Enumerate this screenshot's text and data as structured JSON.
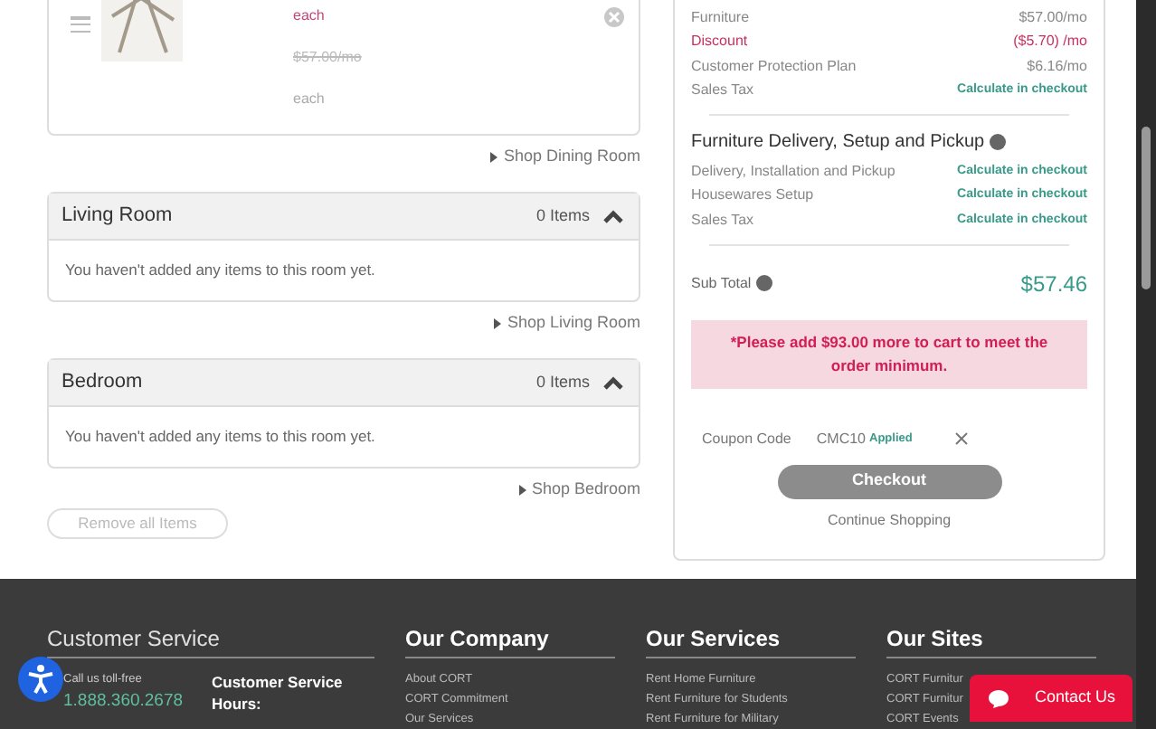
{
  "dining_item": {
    "price_note": "each",
    "original_price": "$57.00/mo",
    "unit": "each"
  },
  "dining_shop_link": "Shop Dining Room",
  "rooms": [
    {
      "name": "Living Room",
      "count": "0 Items",
      "expanded": true,
      "empty_message": "You haven't added any items to this room yet.",
      "shop_link": "Shop Living Room"
    },
    {
      "name": "Bedroom",
      "count": "0 Items",
      "expanded": true,
      "empty_message": "You haven't added any items to this room yet.",
      "shop_link": "Shop Bedroom"
    }
  ],
  "remove_all": "Remove all Items",
  "summary": {
    "lines": [
      {
        "label": "Furniture",
        "value": "$57.00/mo",
        "kind": "charge"
      },
      {
        "label": "Discount",
        "value": "($5.70) /mo",
        "kind": "discount"
      },
      {
        "label": "Customer Protection Plan",
        "value": "$6.16/mo",
        "kind": "charge"
      },
      {
        "label": "Sales Tax",
        "value": "Calculate in checkout",
        "kind": "pending"
      }
    ],
    "delivery_title": "Furniture Delivery, Setup and Pickup",
    "delivery_lines": [
      {
        "label": "Delivery, Installation and Pickup",
        "value": "Calculate in checkout",
        "kind": "pending"
      },
      {
        "label": "Housewares Setup",
        "value": "Calculate in checkout",
        "kind": "pending"
      },
      {
        "label": "Sales Tax",
        "value": "Calculate in checkout",
        "kind": "pending"
      }
    ],
    "subtotal_label": "Sub Total",
    "subtotal": "$57.46",
    "warning": "*Please add $93.00 more to cart to meet the order minimum.",
    "coupon_label": "Coupon Code",
    "coupon_code": "CMC10",
    "coupon_status": "Applied",
    "checkout": "Checkout",
    "continue_shopping": "Continue Shopping"
  },
  "footer": {
    "customer_service": {
      "title": "Customer Service",
      "call_label": "Call us toll-free",
      "phone": "1.888.360.2678",
      "hours_title": "Customer Service Hours:"
    },
    "columns": [
      {
        "title": "Our Company",
        "links": [
          "About CORT",
          "CORT Commitment",
          "Our Services"
        ]
      },
      {
        "title": "Our Services",
        "links": [
          "Rent Home Furniture",
          "Rent Furniture for Students",
          "Rent Furniture for Military"
        ]
      },
      {
        "title": "Our Sites",
        "links": [
          "CORT Furnitur",
          "CORT Furnitur",
          "CORT Events"
        ]
      }
    ],
    "contact_button": "Contact Us"
  }
}
